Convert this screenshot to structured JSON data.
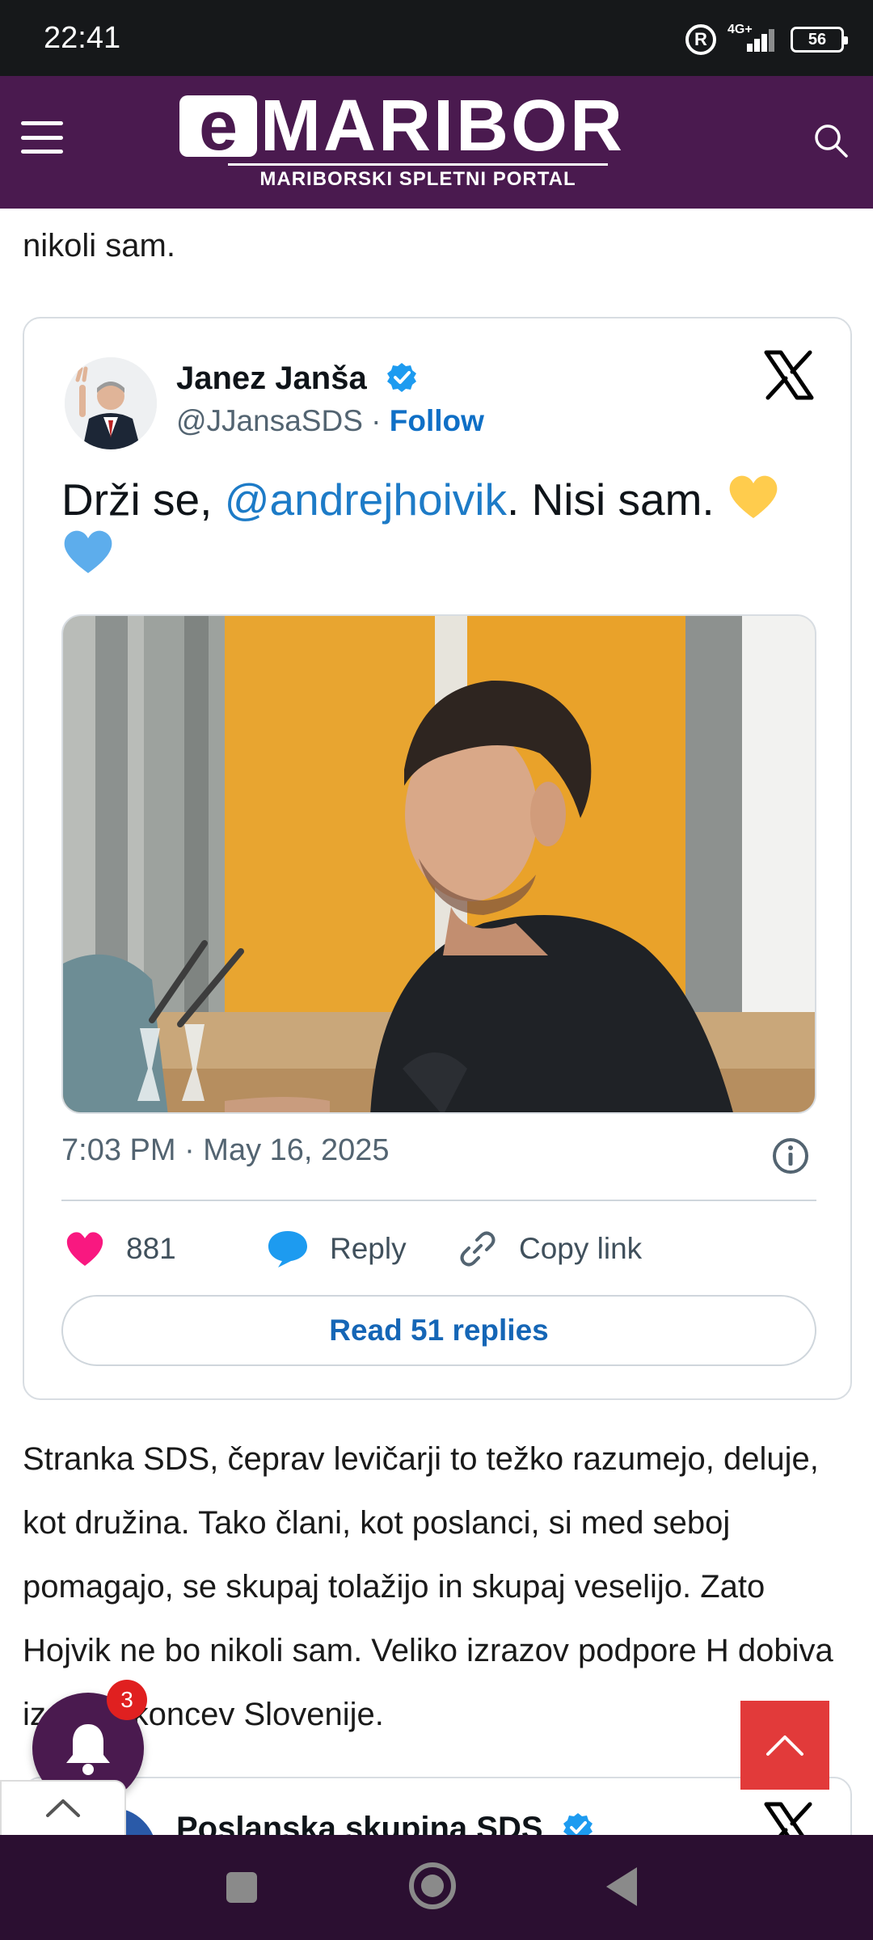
{
  "status_bar": {
    "time": "22:41",
    "network": "4G+",
    "battery": "56"
  },
  "header": {
    "logo_e": "e",
    "logo_word": "MARIBOR",
    "tagline": "MARIBORSKI SPLETNI PORTAL",
    "brand_color": "#4a1a4f"
  },
  "article": {
    "para_top": "nikoli sam.",
    "tweet": {
      "author_name": "Janez Janša",
      "handle": "@JJansaSDS",
      "separator": "·",
      "follow_label": "Follow",
      "text_before": "Drži se, ",
      "mention": "@andrejhoivik",
      "text_after": ". Nisi sam. ",
      "emoji": [
        "yellow-heart",
        "blue-heart"
      ],
      "timestamp": "7:03 PM · May 16, 2025",
      "likes": "881",
      "reply_label": "Reply",
      "copy_label": "Copy link",
      "read_replies": "Read 51 replies"
    },
    "body_para": "Stranka SDS, čeprav levičarji to težko razumejo, deluje, kot družina. Tako člani, kot poslanci, si med seboj pomagajo, se skupaj tolažijo in skupaj veselijo. Zato Hojvik ne bo nikoli sam. Veliko izrazov podpore H dobiva iz vseh koncev Slovenije.",
    "tweet2": {
      "author_name": "Poslanska skupina SDS"
    }
  },
  "floating": {
    "notification_count": "3",
    "scroll_top_color": "#e23a3a"
  }
}
